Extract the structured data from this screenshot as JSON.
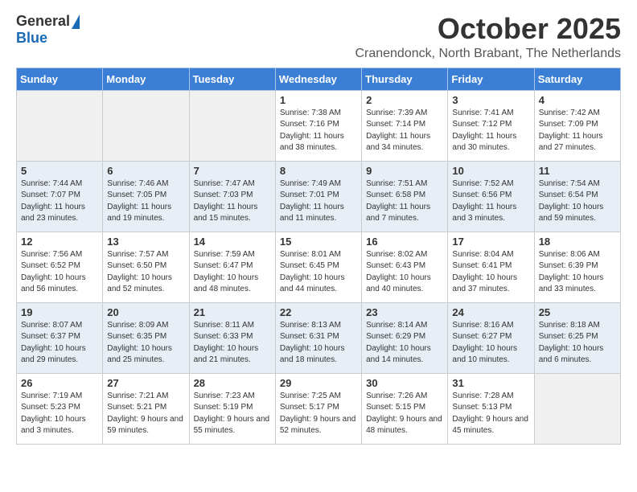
{
  "logo": {
    "general": "General",
    "blue": "Blue"
  },
  "header": {
    "month": "October 2025",
    "location": "Cranendonck, North Brabant, The Netherlands"
  },
  "weekdays": [
    "Sunday",
    "Monday",
    "Tuesday",
    "Wednesday",
    "Thursday",
    "Friday",
    "Saturday"
  ],
  "weeks": [
    [
      {
        "day": "",
        "sunrise": "",
        "sunset": "",
        "daylight": ""
      },
      {
        "day": "",
        "sunrise": "",
        "sunset": "",
        "daylight": ""
      },
      {
        "day": "",
        "sunrise": "",
        "sunset": "",
        "daylight": ""
      },
      {
        "day": "1",
        "sunrise": "Sunrise: 7:38 AM",
        "sunset": "Sunset: 7:16 PM",
        "daylight": "Daylight: 11 hours and 38 minutes."
      },
      {
        "day": "2",
        "sunrise": "Sunrise: 7:39 AM",
        "sunset": "Sunset: 7:14 PM",
        "daylight": "Daylight: 11 hours and 34 minutes."
      },
      {
        "day": "3",
        "sunrise": "Sunrise: 7:41 AM",
        "sunset": "Sunset: 7:12 PM",
        "daylight": "Daylight: 11 hours and 30 minutes."
      },
      {
        "day": "4",
        "sunrise": "Sunrise: 7:42 AM",
        "sunset": "Sunset: 7:09 PM",
        "daylight": "Daylight: 11 hours and 27 minutes."
      }
    ],
    [
      {
        "day": "5",
        "sunrise": "Sunrise: 7:44 AM",
        "sunset": "Sunset: 7:07 PM",
        "daylight": "Daylight: 11 hours and 23 minutes."
      },
      {
        "day": "6",
        "sunrise": "Sunrise: 7:46 AM",
        "sunset": "Sunset: 7:05 PM",
        "daylight": "Daylight: 11 hours and 19 minutes."
      },
      {
        "day": "7",
        "sunrise": "Sunrise: 7:47 AM",
        "sunset": "Sunset: 7:03 PM",
        "daylight": "Daylight: 11 hours and 15 minutes."
      },
      {
        "day": "8",
        "sunrise": "Sunrise: 7:49 AM",
        "sunset": "Sunset: 7:01 PM",
        "daylight": "Daylight: 11 hours and 11 minutes."
      },
      {
        "day": "9",
        "sunrise": "Sunrise: 7:51 AM",
        "sunset": "Sunset: 6:58 PM",
        "daylight": "Daylight: 11 hours and 7 minutes."
      },
      {
        "day": "10",
        "sunrise": "Sunrise: 7:52 AM",
        "sunset": "Sunset: 6:56 PM",
        "daylight": "Daylight: 11 hours and 3 minutes."
      },
      {
        "day": "11",
        "sunrise": "Sunrise: 7:54 AM",
        "sunset": "Sunset: 6:54 PM",
        "daylight": "Daylight: 10 hours and 59 minutes."
      }
    ],
    [
      {
        "day": "12",
        "sunrise": "Sunrise: 7:56 AM",
        "sunset": "Sunset: 6:52 PM",
        "daylight": "Daylight: 10 hours and 56 minutes."
      },
      {
        "day": "13",
        "sunrise": "Sunrise: 7:57 AM",
        "sunset": "Sunset: 6:50 PM",
        "daylight": "Daylight: 10 hours and 52 minutes."
      },
      {
        "day": "14",
        "sunrise": "Sunrise: 7:59 AM",
        "sunset": "Sunset: 6:47 PM",
        "daylight": "Daylight: 10 hours and 48 minutes."
      },
      {
        "day": "15",
        "sunrise": "Sunrise: 8:01 AM",
        "sunset": "Sunset: 6:45 PM",
        "daylight": "Daylight: 10 hours and 44 minutes."
      },
      {
        "day": "16",
        "sunrise": "Sunrise: 8:02 AM",
        "sunset": "Sunset: 6:43 PM",
        "daylight": "Daylight: 10 hours and 40 minutes."
      },
      {
        "day": "17",
        "sunrise": "Sunrise: 8:04 AM",
        "sunset": "Sunset: 6:41 PM",
        "daylight": "Daylight: 10 hours and 37 minutes."
      },
      {
        "day": "18",
        "sunrise": "Sunrise: 8:06 AM",
        "sunset": "Sunset: 6:39 PM",
        "daylight": "Daylight: 10 hours and 33 minutes."
      }
    ],
    [
      {
        "day": "19",
        "sunrise": "Sunrise: 8:07 AM",
        "sunset": "Sunset: 6:37 PM",
        "daylight": "Daylight: 10 hours and 29 minutes."
      },
      {
        "day": "20",
        "sunrise": "Sunrise: 8:09 AM",
        "sunset": "Sunset: 6:35 PM",
        "daylight": "Daylight: 10 hours and 25 minutes."
      },
      {
        "day": "21",
        "sunrise": "Sunrise: 8:11 AM",
        "sunset": "Sunset: 6:33 PM",
        "daylight": "Daylight: 10 hours and 21 minutes."
      },
      {
        "day": "22",
        "sunrise": "Sunrise: 8:13 AM",
        "sunset": "Sunset: 6:31 PM",
        "daylight": "Daylight: 10 hours and 18 minutes."
      },
      {
        "day": "23",
        "sunrise": "Sunrise: 8:14 AM",
        "sunset": "Sunset: 6:29 PM",
        "daylight": "Daylight: 10 hours and 14 minutes."
      },
      {
        "day": "24",
        "sunrise": "Sunrise: 8:16 AM",
        "sunset": "Sunset: 6:27 PM",
        "daylight": "Daylight: 10 hours and 10 minutes."
      },
      {
        "day": "25",
        "sunrise": "Sunrise: 8:18 AM",
        "sunset": "Sunset: 6:25 PM",
        "daylight": "Daylight: 10 hours and 6 minutes."
      }
    ],
    [
      {
        "day": "26",
        "sunrise": "Sunrise: 7:19 AM",
        "sunset": "Sunset: 5:23 PM",
        "daylight": "Daylight: 10 hours and 3 minutes."
      },
      {
        "day": "27",
        "sunrise": "Sunrise: 7:21 AM",
        "sunset": "Sunset: 5:21 PM",
        "daylight": "Daylight: 9 hours and 59 minutes."
      },
      {
        "day": "28",
        "sunrise": "Sunrise: 7:23 AM",
        "sunset": "Sunset: 5:19 PM",
        "daylight": "Daylight: 9 hours and 55 minutes."
      },
      {
        "day": "29",
        "sunrise": "Sunrise: 7:25 AM",
        "sunset": "Sunset: 5:17 PM",
        "daylight": "Daylight: 9 hours and 52 minutes."
      },
      {
        "day": "30",
        "sunrise": "Sunrise: 7:26 AM",
        "sunset": "Sunset: 5:15 PM",
        "daylight": "Daylight: 9 hours and 48 minutes."
      },
      {
        "day": "31",
        "sunrise": "Sunrise: 7:28 AM",
        "sunset": "Sunset: 5:13 PM",
        "daylight": "Daylight: 9 hours and 45 minutes."
      },
      {
        "day": "",
        "sunrise": "",
        "sunset": "",
        "daylight": ""
      }
    ]
  ]
}
